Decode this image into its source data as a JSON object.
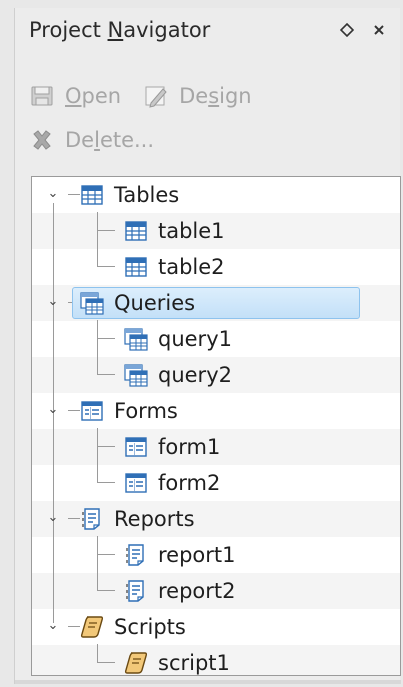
{
  "panel": {
    "title_prefix": "Project ",
    "title_mnemonic": "N",
    "title_suffix": "avigator",
    "float_button_glyph": "⋄",
    "close_button_glyph": "×"
  },
  "toolbar": {
    "open": {
      "pre": "",
      "mn": "O",
      "post": "pen",
      "icon": "open-icon"
    },
    "design": {
      "pre": "De",
      "mn": "s",
      "post": "ign",
      "icon": "design-icon"
    },
    "delete": {
      "pre": "De",
      "mn": "l",
      "post": "ete...",
      "icon": "delete-icon"
    }
  },
  "tree": {
    "tables": {
      "label": "Tables",
      "icon": "table-icon",
      "expanded": true,
      "children": [
        "table1",
        "table2"
      ]
    },
    "queries": {
      "label": "Queries",
      "icon": "query-icon",
      "expanded": true,
      "selected": true,
      "children": [
        "query1",
        "query2"
      ]
    },
    "forms": {
      "label": "Forms",
      "icon": "form-icon",
      "expanded": true,
      "children": [
        "form1",
        "form2"
      ]
    },
    "reports": {
      "label": "Reports",
      "icon": "report-icon",
      "expanded": true,
      "children": [
        "report1",
        "report2"
      ]
    },
    "scripts": {
      "label": "Scripts",
      "icon": "script-icon",
      "expanded": true,
      "children": [
        "script1"
      ]
    }
  },
  "colors": {
    "selection_fill": "#c3e0f8",
    "selection_border": "#8ec3ee",
    "icon_blue": "#2f6fb6",
    "disabled_text": "#a6a6a6"
  }
}
